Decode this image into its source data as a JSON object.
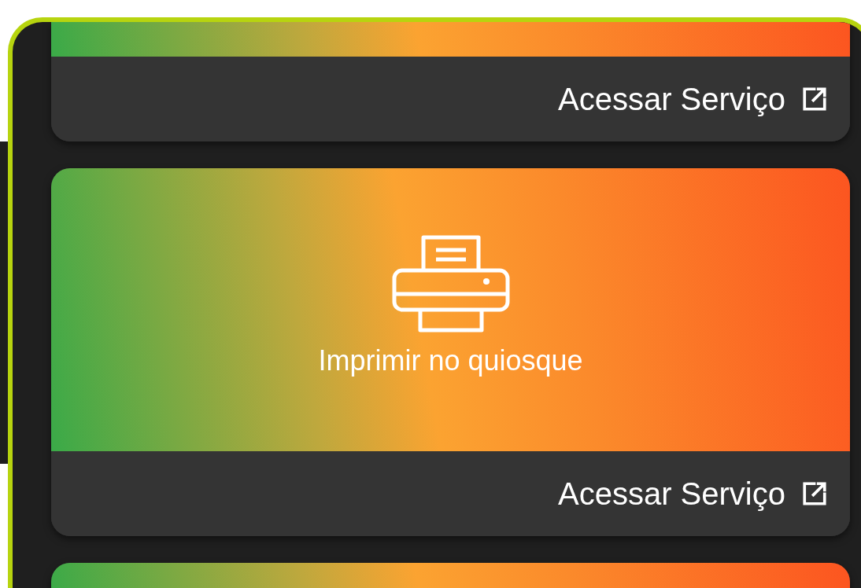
{
  "cards": [
    {
      "kind": "footer-only",
      "link": "Acessar Serviço"
    },
    {
      "kind": "full",
      "title": "Imprimir no quiosque",
      "link": "Acessar Serviço"
    },
    {
      "kind": "banner-only"
    }
  ]
}
